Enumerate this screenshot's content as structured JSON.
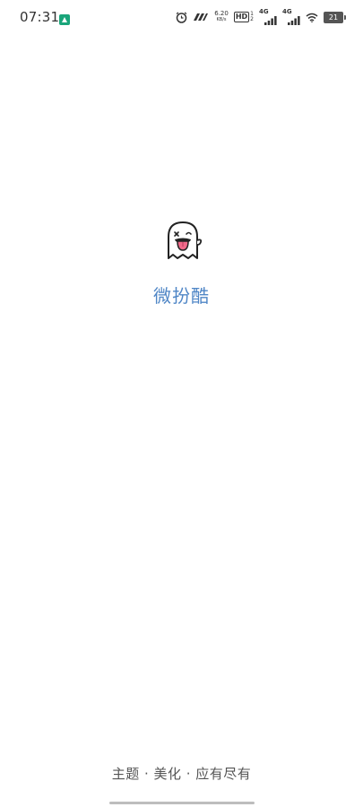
{
  "status_bar": {
    "time": "07:31",
    "net_speed_value": "6.20",
    "net_speed_unit": "KB/s",
    "hd_label": "HD",
    "sim_top": "1",
    "sim_bottom": "2",
    "network_1": "4G",
    "network_2": "4G",
    "battery_level": "21",
    "icons": [
      "app-notification-icon",
      "alarm-icon",
      "nfc-icon",
      "signal-icon",
      "wifi-icon",
      "battery-icon"
    ]
  },
  "splash": {
    "app_name": "微扮酷",
    "slogan": "主题 · 美化 · 应有尽有"
  },
  "colors": {
    "app_name": "#4f86c6",
    "slogan": "#555555",
    "background": "#ffffff",
    "logo_tongue": "#f06a8a"
  }
}
